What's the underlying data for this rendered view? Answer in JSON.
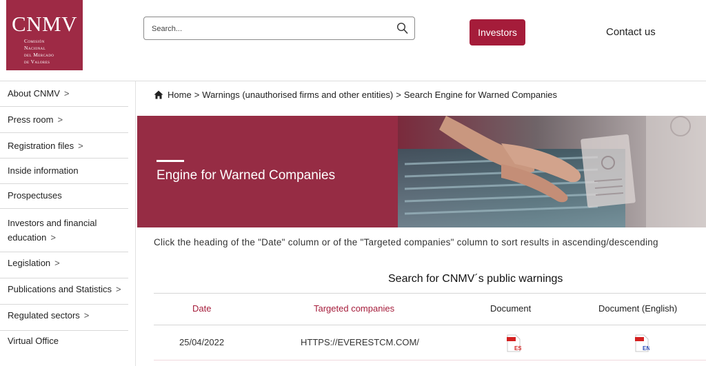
{
  "logo": {
    "main": "CNMV",
    "sub": [
      "Comisión",
      "Nacional",
      "del Mercado",
      "de Valores"
    ]
  },
  "search": {
    "placeholder": "Search..."
  },
  "header": {
    "investors_label": "Investors",
    "contact_label": "Contact us"
  },
  "sidebar": {
    "items": [
      {
        "label": "About CNMV",
        "chevron": true
      },
      {
        "label": "Press room",
        "chevron": true
      },
      {
        "label": "Registration files",
        "chevron": true
      },
      {
        "label": "Inside information",
        "chevron": false
      },
      {
        "label": "Prospectuses",
        "chevron": false
      },
      {
        "label": "Investors and financial",
        "label2": "education",
        "chevron": true
      },
      {
        "label": "Legislation",
        "chevron": true
      },
      {
        "label": "Publications and Statistics",
        "chevron": true
      },
      {
        "label": "Regulated sectors",
        "chevron": true
      },
      {
        "label": "Virtual Office",
        "chevron": false
      }
    ],
    "chevron_glyph": ">"
  },
  "breadcrumb": {
    "home": "Home",
    "separator": ">",
    "items": [
      "Warnings (unauthorised firms and other entities)",
      "Search Engine for Warned Companies"
    ]
  },
  "banner": {
    "title": "Engine for Warned Companies"
  },
  "instructions": "Click the heading of the \"Date\" column or of the \"Targeted companies\" column to sort results in ascending/descending",
  "table": {
    "title": "Search for CNMV´s public warnings",
    "headers": [
      "Date",
      "Targeted companies",
      "Document",
      "Document (English)"
    ],
    "rows": [
      {
        "date": "25/04/2022",
        "company": "HTTPS://EVERESTCM.COM/",
        "doc_badge": "ES",
        "doc_en_badge": "EN"
      }
    ]
  },
  "colors": {
    "brand": "#9e2a45",
    "accent": "#a51c3a"
  }
}
